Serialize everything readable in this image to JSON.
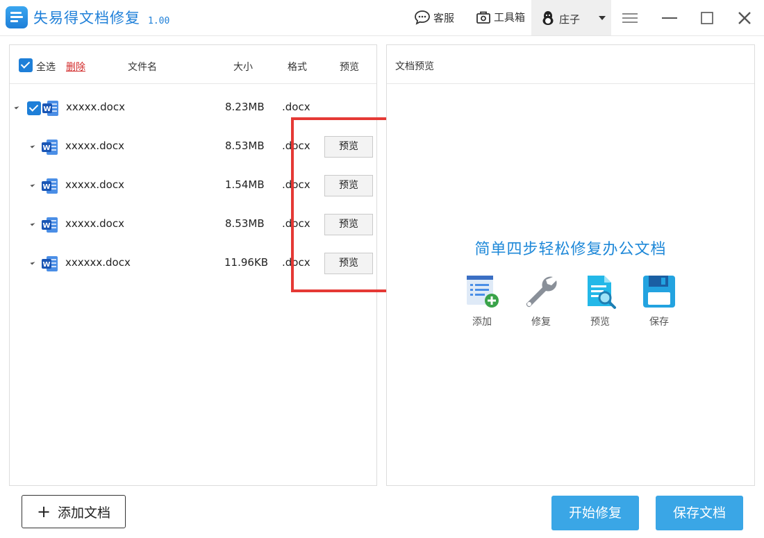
{
  "app": {
    "title": "失易得文档修复",
    "version": "1.00"
  },
  "toolbar": {
    "service_label": "客服",
    "toolbox_label": "工具箱",
    "user_name": "庄子"
  },
  "list": {
    "select_all_label": "全选",
    "delete_label": "删除",
    "columns": {
      "name": "文件名",
      "size": "大小",
      "format": "格式",
      "preview": "预览"
    },
    "parent": {
      "name": "xxxxx.docx",
      "size": "8.23MB",
      "format": ".docx"
    },
    "children": [
      {
        "name": "xxxxx.docx",
        "size": "8.53MB",
        "format": ".docx",
        "action": "预览"
      },
      {
        "name": "xxxxx.docx",
        "size": "1.54MB",
        "format": ".docx",
        "action": "预览"
      },
      {
        "name": "xxxxx.docx",
        "size": "8.53MB",
        "format": ".docx",
        "action": "预览"
      },
      {
        "name": "xxxxxx.docx",
        "size": "11.96KB",
        "format": ".docx",
        "action": "预览"
      }
    ]
  },
  "preview_panel": {
    "title": "文档预览",
    "steps_title": "简单四步轻松修复办公文档",
    "steps": [
      {
        "label": "添加",
        "icon": "add-document-icon"
      },
      {
        "label": "修复",
        "icon": "wrench-icon"
      },
      {
        "label": "预览",
        "icon": "preview-document-icon"
      },
      {
        "label": "保存",
        "icon": "floppy-disk-icon"
      }
    ]
  },
  "actions": {
    "add_label": "添加文档",
    "repair_label": "开始修复",
    "save_label": "保存文档"
  },
  "colors": {
    "accent": "#1e7fd8",
    "button_blue": "#3aa6e6",
    "highlight_red": "#e53935",
    "delete_red": "#d22a2a"
  }
}
